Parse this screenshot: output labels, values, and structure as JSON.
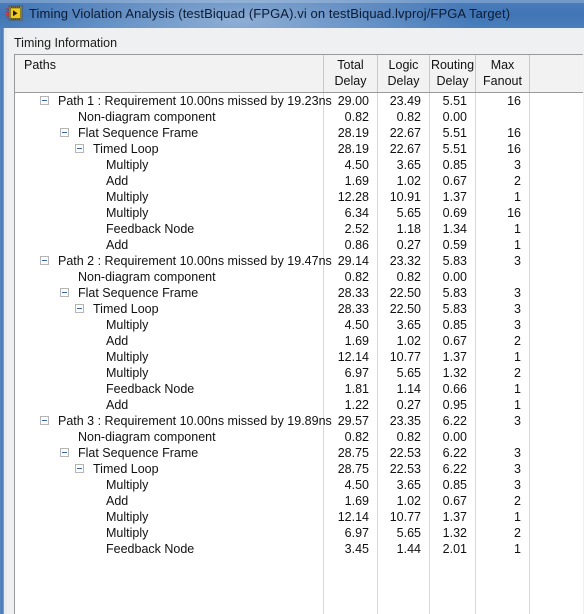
{
  "window": {
    "title": "Timing Violation Analysis (testBiquad (FPGA).vi on testBiquad.lvproj/FPGA Target)",
    "icon": "labview-vi-icon",
    "titlebar_color": "#4577b6"
  },
  "group": {
    "label": "Timing Information"
  },
  "table": {
    "columns": [
      {
        "key": "paths",
        "line1": "Paths",
        "line2": ""
      },
      {
        "key": "total",
        "line1": "Total",
        "line2": "Delay"
      },
      {
        "key": "logic",
        "line1": "Logic",
        "line2": "Delay"
      },
      {
        "key": "routing",
        "line1": "Routing",
        "line2": "Delay"
      },
      {
        "key": "fanout",
        "line1": "Max",
        "line2": "Fanout"
      },
      {
        "key": "spare",
        "line1": "",
        "line2": ""
      }
    ],
    "rows": [
      {
        "label": "Path 1 : Requirement 10.00ns missed by 19.23ns",
        "level": 0,
        "expander": true,
        "total": "29.00",
        "logic": "23.49",
        "routing": "5.51",
        "fanout": "16"
      },
      {
        "label": "Non-diagram component",
        "level": 1,
        "expander": false,
        "total": "0.82",
        "logic": "0.82",
        "routing": "0.00",
        "fanout": ""
      },
      {
        "label": "Flat Sequence Frame",
        "level": 1,
        "expander": true,
        "total": "28.19",
        "logic": "22.67",
        "routing": "5.51",
        "fanout": "16"
      },
      {
        "label": "Timed Loop",
        "level": 2,
        "expander": true,
        "total": "28.19",
        "logic": "22.67",
        "routing": "5.51",
        "fanout": "16"
      },
      {
        "label": "Multiply",
        "level": 3,
        "expander": false,
        "total": "4.50",
        "logic": "3.65",
        "routing": "0.85",
        "fanout": "3"
      },
      {
        "label": "Add",
        "level": 3,
        "expander": false,
        "total": "1.69",
        "logic": "1.02",
        "routing": "0.67",
        "fanout": "2"
      },
      {
        "label": "Multiply",
        "level": 3,
        "expander": false,
        "total": "12.28",
        "logic": "10.91",
        "routing": "1.37",
        "fanout": "1"
      },
      {
        "label": "Multiply",
        "level": 3,
        "expander": false,
        "total": "6.34",
        "logic": "5.65",
        "routing": "0.69",
        "fanout": "16"
      },
      {
        "label": "Feedback Node",
        "level": 3,
        "expander": false,
        "total": "2.52",
        "logic": "1.18",
        "routing": "1.34",
        "fanout": "1"
      },
      {
        "label": "Add",
        "level": 3,
        "expander": false,
        "total": "0.86",
        "logic": "0.27",
        "routing": "0.59",
        "fanout": "1"
      },
      {
        "label": "Path 2 : Requirement 10.00ns missed by 19.47ns",
        "level": 0,
        "expander": true,
        "total": "29.14",
        "logic": "23.32",
        "routing": "5.83",
        "fanout": "3"
      },
      {
        "label": "Non-diagram component",
        "level": 1,
        "expander": false,
        "total": "0.82",
        "logic": "0.82",
        "routing": "0.00",
        "fanout": ""
      },
      {
        "label": "Flat Sequence Frame",
        "level": 1,
        "expander": true,
        "total": "28.33",
        "logic": "22.50",
        "routing": "5.83",
        "fanout": "3"
      },
      {
        "label": "Timed Loop",
        "level": 2,
        "expander": true,
        "total": "28.33",
        "logic": "22.50",
        "routing": "5.83",
        "fanout": "3"
      },
      {
        "label": "Multiply",
        "level": 3,
        "expander": false,
        "total": "4.50",
        "logic": "3.65",
        "routing": "0.85",
        "fanout": "3"
      },
      {
        "label": "Add",
        "level": 3,
        "expander": false,
        "total": "1.69",
        "logic": "1.02",
        "routing": "0.67",
        "fanout": "2"
      },
      {
        "label": "Multiply",
        "level": 3,
        "expander": false,
        "total": "12.14",
        "logic": "10.77",
        "routing": "1.37",
        "fanout": "1"
      },
      {
        "label": "Multiply",
        "level": 3,
        "expander": false,
        "total": "6.97",
        "logic": "5.65",
        "routing": "1.32",
        "fanout": "2"
      },
      {
        "label": "Feedback Node",
        "level": 3,
        "expander": false,
        "total": "1.81",
        "logic": "1.14",
        "routing": "0.66",
        "fanout": "1"
      },
      {
        "label": "Add",
        "level": 3,
        "expander": false,
        "total": "1.22",
        "logic": "0.27",
        "routing": "0.95",
        "fanout": "1"
      },
      {
        "label": "Path 3 : Requirement 10.00ns missed by 19.89ns",
        "level": 0,
        "expander": true,
        "total": "29.57",
        "logic": "23.35",
        "routing": "6.22",
        "fanout": "3"
      },
      {
        "label": "Non-diagram component",
        "level": 1,
        "expander": false,
        "total": "0.82",
        "logic": "0.82",
        "routing": "0.00",
        "fanout": ""
      },
      {
        "label": "Flat Sequence Frame",
        "level": 1,
        "expander": true,
        "total": "28.75",
        "logic": "22.53",
        "routing": "6.22",
        "fanout": "3"
      },
      {
        "label": "Timed Loop",
        "level": 2,
        "expander": true,
        "total": "28.75",
        "logic": "22.53",
        "routing": "6.22",
        "fanout": "3"
      },
      {
        "label": "Multiply",
        "level": 3,
        "expander": false,
        "total": "4.50",
        "logic": "3.65",
        "routing": "0.85",
        "fanout": "3"
      },
      {
        "label": "Add",
        "level": 3,
        "expander": false,
        "total": "1.69",
        "logic": "1.02",
        "routing": "0.67",
        "fanout": "2"
      },
      {
        "label": "Multiply",
        "level": 3,
        "expander": false,
        "total": "12.14",
        "logic": "10.77",
        "routing": "1.37",
        "fanout": "1"
      },
      {
        "label": "Multiply",
        "level": 3,
        "expander": false,
        "total": "6.97",
        "logic": "5.65",
        "routing": "1.32",
        "fanout": "2"
      },
      {
        "label": "Feedback Node",
        "level": 3,
        "expander": false,
        "total": "3.45",
        "logic": "1.44",
        "routing": "2.01",
        "fanout": "1"
      }
    ]
  }
}
